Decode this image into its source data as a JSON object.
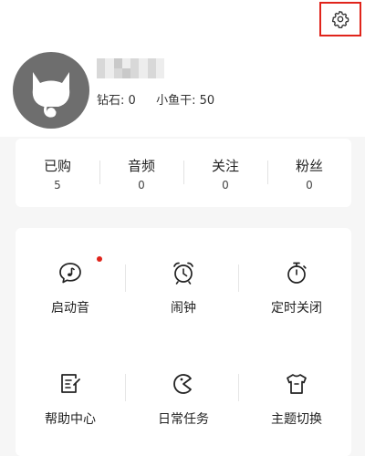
{
  "profile": {
    "diamond_label": "钻石:",
    "diamond_value": "0",
    "fish_label": "小鱼干:",
    "fish_value": "50"
  },
  "counts": [
    {
      "label": "已购",
      "value": "5"
    },
    {
      "label": "音频",
      "value": "0"
    },
    {
      "label": "关注",
      "value": "0"
    },
    {
      "label": "粉丝",
      "value": "0"
    }
  ],
  "tools": [
    {
      "label": "启动音",
      "icon": "music-bubble-icon",
      "badge": true
    },
    {
      "label": "闹钟",
      "icon": "alarm-clock-icon"
    },
    {
      "label": "定时关闭",
      "icon": "timer-icon"
    },
    {
      "label": "帮助中心",
      "icon": "help-document-icon"
    },
    {
      "label": "日常任务",
      "icon": "pacman-icon"
    },
    {
      "label": "主题切换",
      "icon": "tshirt-icon"
    }
  ],
  "colors": {
    "highlight_border": "#e0241b",
    "badge_dot": "#e0241b",
    "avatar_bg": "#6e6e6e"
  }
}
